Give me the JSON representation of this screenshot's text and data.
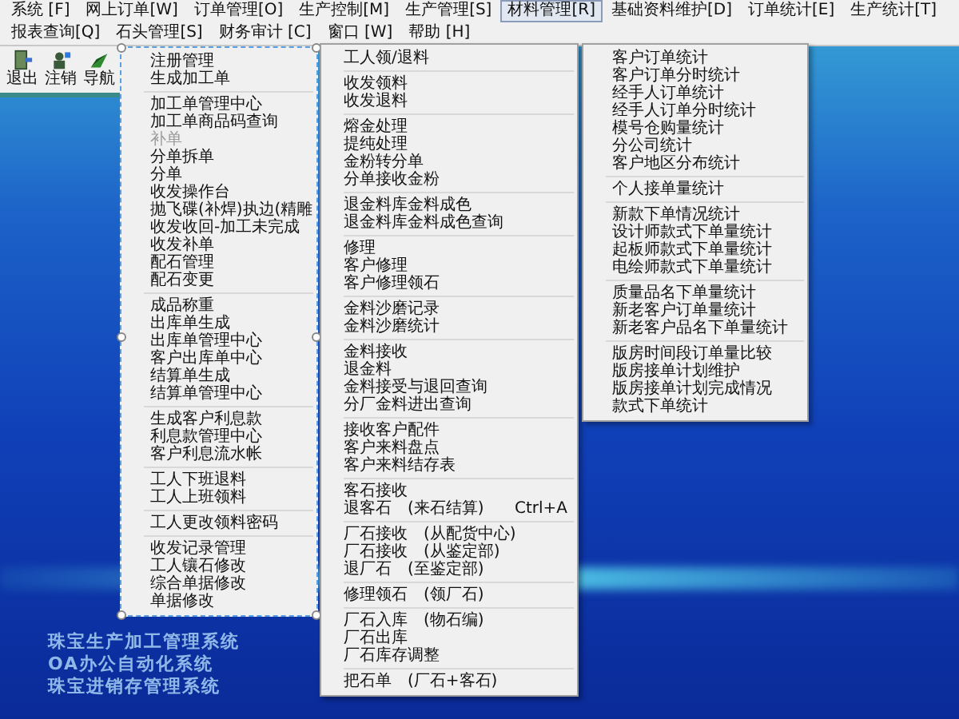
{
  "menu_bar": [
    {
      "label": "系统 [F]",
      "selected": false
    },
    {
      "label": "网上订单[W]",
      "selected": false
    },
    {
      "label": "订单管理[O]",
      "selected": false
    },
    {
      "label": "生产控制[M]",
      "selected": false
    },
    {
      "label": "生产管理[S]",
      "selected": false
    },
    {
      "label": "材料管理[R]",
      "selected": true
    },
    {
      "label": "基础资料维护[D]",
      "selected": false
    },
    {
      "label": "订单统计[E]",
      "selected": false
    },
    {
      "label": "生产统计[T]",
      "selected": false
    },
    {
      "label": "报表查询[Q]",
      "selected": false
    },
    {
      "label": "石头管理[S]",
      "selected": false
    },
    {
      "label": "财务审计 [C]",
      "selected": false
    },
    {
      "label": "窗口 [W]",
      "selected": false
    },
    {
      "label": "帮助 [H]",
      "selected": false
    }
  ],
  "toolbar": [
    {
      "kind": "exit",
      "label": "退出"
    },
    {
      "kind": "logout",
      "label": "注销"
    },
    {
      "kind": "navigate",
      "label": "导航"
    }
  ],
  "menus": [
    {
      "kind": "design",
      "groups": [
        [
          {
            "label": "注册管理",
            "disabled": false
          },
          {
            "label": "生成加工单",
            "disabled": false
          }
        ],
        [
          {
            "label": "加工单管理中心",
            "disabled": false
          },
          {
            "label": "加工单商品码查询",
            "disabled": false
          },
          {
            "label": "补单",
            "disabled": true
          },
          {
            "label": "分单拆单",
            "disabled": false
          },
          {
            "label": "分单",
            "disabled": false
          },
          {
            "label": "收发操作台",
            "disabled": false
          },
          {
            "label": "抛飞碟(补焊)执边(精雕",
            "disabled": false
          },
          {
            "label": "收发收回-加工未完成",
            "disabled": false
          },
          {
            "label": "收发补单",
            "disabled": false
          },
          {
            "label": "配石管理",
            "disabled": false
          },
          {
            "label": "配石变更",
            "disabled": false
          }
        ],
        [
          {
            "label": "成品称重",
            "disabled": false
          },
          {
            "label": "出库单生成",
            "disabled": false
          },
          {
            "label": "出库单管理中心",
            "disabled": false
          },
          {
            "label": "客户出库单中心",
            "disabled": false
          },
          {
            "label": "结算单生成",
            "disabled": false
          },
          {
            "label": "结算单管理中心",
            "disabled": false
          }
        ],
        [
          {
            "label": "生成客户利息款",
            "disabled": false
          },
          {
            "label": "利息款管理中心",
            "disabled": false
          },
          {
            "label": "客户利息流水帐",
            "disabled": false
          }
        ],
        [
          {
            "label": "工人下班退料",
            "disabled": false
          },
          {
            "label": "工人上班领料",
            "disabled": false
          }
        ],
        [
          {
            "label": "工人更改领料密码",
            "disabled": false
          }
        ],
        [
          {
            "label": "收发记录管理",
            "disabled": false
          },
          {
            "label": "工人镶石修改",
            "disabled": false
          },
          {
            "label": "综合单据修改",
            "disabled": false
          },
          {
            "label": "单据修改",
            "disabled": false
          }
        ]
      ]
    },
    {
      "kind": "dropdown",
      "groups": [
        [
          {
            "label": "工人领/退料",
            "disabled": false
          }
        ],
        [
          {
            "label": "收发领料",
            "disabled": false
          },
          {
            "label": "收发退料",
            "disabled": false
          }
        ],
        [
          {
            "label": "熔金处理",
            "disabled": false
          },
          {
            "label": "提纯处理",
            "disabled": false
          },
          {
            "label": "金粉转分单",
            "disabled": false
          },
          {
            "label": "分单接收金粉",
            "disabled": false
          }
        ],
        [
          {
            "label": "退金料库金料成色",
            "disabled": false
          },
          {
            "label": "退金料库金料成色查询",
            "disabled": false
          }
        ],
        [
          {
            "label": "修理",
            "disabled": false
          },
          {
            "label": "客户修理",
            "disabled": false
          },
          {
            "label": "客户修理领石",
            "disabled": false
          }
        ],
        [
          {
            "label": "金料沙磨记录",
            "disabled": false
          },
          {
            "label": "金料沙磨统计",
            "disabled": false
          }
        ],
        [
          {
            "label": "金料接收",
            "disabled": false
          },
          {
            "label": "退金料",
            "disabled": false
          },
          {
            "label": "金料接受与退回查询",
            "disabled": false
          },
          {
            "label": "分厂金料进出查询",
            "disabled": false
          }
        ],
        [
          {
            "label": "接收客户配件",
            "disabled": false
          },
          {
            "label": "客户来料盘点",
            "disabled": false
          },
          {
            "label": "客户来料结存表",
            "disabled": false
          }
        ],
        [
          {
            "label": "客石接收",
            "disabled": false
          },
          {
            "label": "退客石　(来石结算)",
            "shortcut": "Ctrl+A",
            "disabled": false
          }
        ],
        [
          {
            "label": "厂石接收　(从配货中心)",
            "disabled": false
          },
          {
            "label": "厂石接收　(从鉴定部)",
            "disabled": false
          },
          {
            "label": "退厂石　(至鉴定部)",
            "disabled": false
          }
        ],
        [
          {
            "label": "修理领石　(领厂石)",
            "disabled": false
          }
        ],
        [
          {
            "label": "厂石入库　(物石编)",
            "disabled": false
          },
          {
            "label": "厂石出库",
            "disabled": false
          },
          {
            "label": "厂石库存调整",
            "disabled": false
          }
        ],
        [
          {
            "label": "把石单　(厂石+客石)",
            "disabled": false
          }
        ]
      ]
    },
    {
      "kind": "dropdown",
      "groups": [
        [
          {
            "label": "客户订单统计",
            "disabled": false
          },
          {
            "label": "客户订单分时统计",
            "disabled": false
          },
          {
            "label": "经手人订单统计",
            "disabled": false
          },
          {
            "label": "经手人订单分时统计",
            "disabled": false
          },
          {
            "label": "模号仓购量统计",
            "disabled": false
          },
          {
            "label": "分公司统计",
            "disabled": false
          },
          {
            "label": "客户地区分布统计",
            "disabled": false
          }
        ],
        [
          {
            "label": "个人接单量统计",
            "disabled": false
          }
        ],
        [
          {
            "label": "新款下单情况统计",
            "disabled": false
          },
          {
            "label": "设计师款式下单量统计",
            "disabled": false
          },
          {
            "label": "起板师款式下单量统计",
            "disabled": false
          },
          {
            "label": "电绘师款式下单量统计",
            "disabled": false
          }
        ],
        [
          {
            "label": "质量品名下单量统计",
            "disabled": false
          },
          {
            "label": "新老客户订单量统计",
            "disabled": false
          },
          {
            "label": "新老客户品名下单量统计",
            "disabled": false
          }
        ],
        [
          {
            "label": "版房时间段订单量比较",
            "disabled": false
          },
          {
            "label": "版房接单计划维护",
            "disabled": false
          },
          {
            "label": "版房接单计划完成情况",
            "disabled": false
          },
          {
            "label": "款式下单统计",
            "disabled": false
          }
        ]
      ]
    }
  ],
  "desktop_captions": [
    "珠宝生产加工管理系统",
    "OA办公自动化系统",
    "珠宝进销存管理系统"
  ]
}
